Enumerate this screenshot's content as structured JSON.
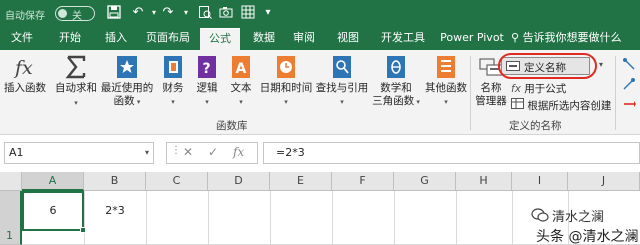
{
  "titlebar": {
    "autosave_label": "自动保存",
    "autosave_state": "关"
  },
  "tabs": [
    {
      "label": "文件",
      "active": false
    },
    {
      "label": "开始",
      "active": false
    },
    {
      "label": "插入",
      "active": false
    },
    {
      "label": "页面布局",
      "active": false
    },
    {
      "label": "公式",
      "active": true
    },
    {
      "label": "数据",
      "active": false
    },
    {
      "label": "审阅",
      "active": false
    },
    {
      "label": "视图",
      "active": false
    },
    {
      "label": "开发工具",
      "active": false
    },
    {
      "label": "Power Pivot",
      "active": false
    }
  ],
  "tellme": "告诉我你想要做什么",
  "ribbon": {
    "function_library": {
      "insert_function": "插入函数",
      "autosum": "自动求和",
      "recent_line1": "最近使用的",
      "recent_line2": "函数",
      "financial": "财务",
      "logical": "逻辑",
      "text": "文本",
      "datetime": "日期和时间",
      "lookup": "查找与引用",
      "math_line1": "数学和",
      "math_line2": "三角函数",
      "more": "其他函数",
      "group_label": "函数库"
    },
    "defined_names": {
      "name_manager_line1": "名称",
      "name_manager_line2": "管理器",
      "define_name": "定义名称",
      "use_in_formula": "用于公式",
      "create_from_selection": "根据所选内容创建",
      "group_label": "定义的名称"
    }
  },
  "formula_bar": {
    "name_box": "A1",
    "formula": "=2*3"
  },
  "grid": {
    "columns": [
      "A",
      "B",
      "C",
      "D",
      "E",
      "F",
      "G",
      "H",
      "I",
      "J"
    ],
    "rows": [
      "1"
    ],
    "cells": {
      "A1": "6",
      "B1": "2*3"
    }
  },
  "watermark": {
    "line1": "清水之澜",
    "line2": "头条 @清水之澜"
  },
  "colors": {
    "brand": "#217346",
    "highlight": "#e02b20"
  }
}
